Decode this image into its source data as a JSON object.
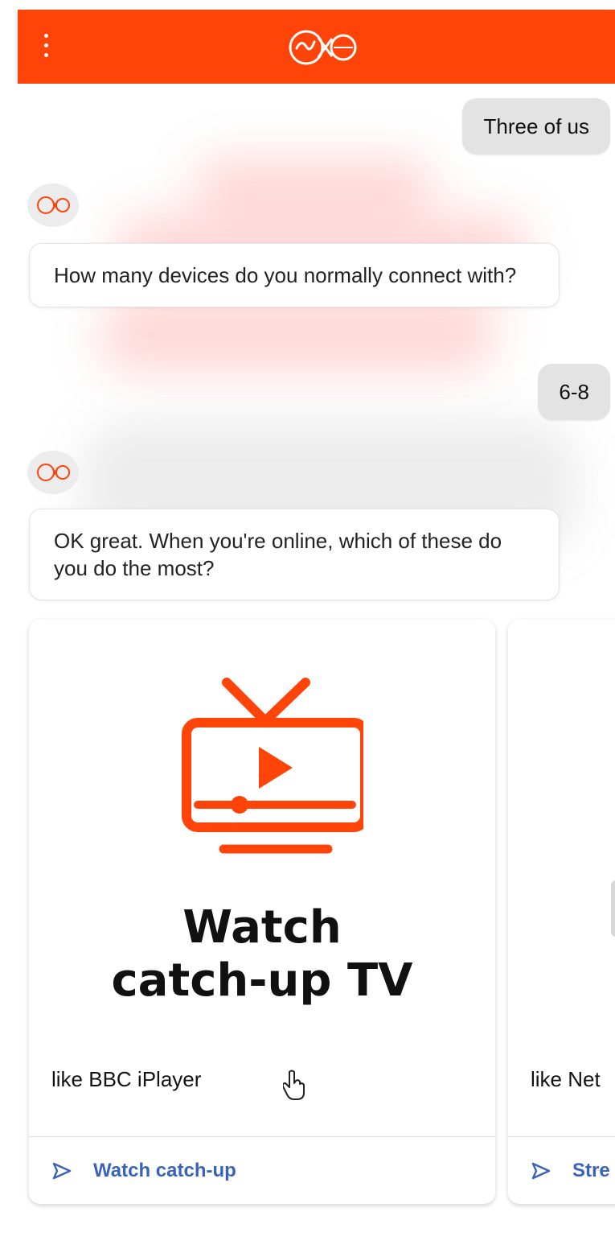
{
  "app": {
    "brand_color": "#ff4409",
    "link_color": "#3a63b8",
    "menu_icon": "more-vertical-icon",
    "logo_icon": "virgin-media-logo"
  },
  "conversation": {
    "user_reply_1": "Three of us",
    "bot_question_1": "How many devices do you normally connect with?",
    "user_reply_2": "6-8",
    "bot_question_2": "OK great. When you're online, which of these do you do the most?"
  },
  "cards": [
    {
      "icon": "tv-play-icon",
      "title_line1": "Watch",
      "title_line2": "catch-up TV",
      "subtitle": "like BBC iPlayer",
      "action_label": "Watch catch-up",
      "action_icon": "send-arrow-icon"
    },
    {
      "subtitle": "like Net",
      "action_label": "Stre",
      "action_icon": "send-arrow-icon"
    }
  ]
}
